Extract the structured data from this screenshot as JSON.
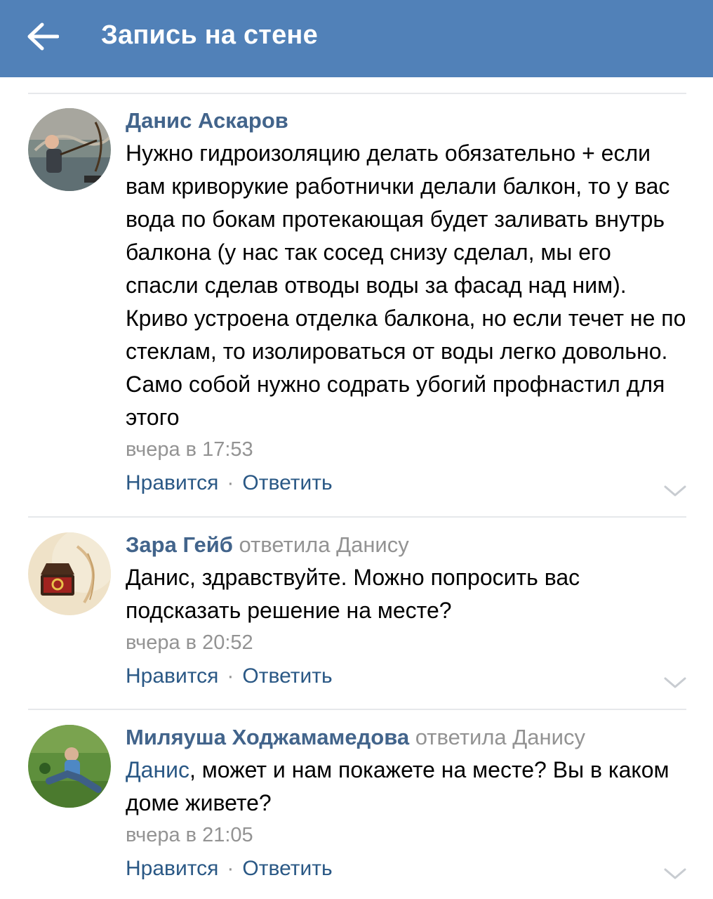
{
  "header": {
    "title": "Запись на стене",
    "back_icon": "arrow-left-icon",
    "background": "#5181b8"
  },
  "colors": {
    "author": "#42648b",
    "link": "#2a5885",
    "muted": "#939393",
    "text": "#000000"
  },
  "comments": [
    {
      "author": "Данис Аскаров",
      "replied_to": "",
      "mention": "",
      "text": "Нужно гидроизоляцию делать обязательно + если вам криворукие работнички делали балкон, то у вас вода по бокам протекающая будет заливать внутрь балкона (у нас так сосед снизу сделал, мы его спасли сделав отводы воды за фасад над ним). Криво устроена отделка балкона, но если течет не по стеклам, то изолироваться от воды легко довольно. Само собой нужно содрать убогий профнастил для этого",
      "time": "вчера в 17:53",
      "like_label": "Нравится",
      "separator": "·",
      "reply_label": "Ответить"
    },
    {
      "author": "Зара Гейб",
      "replied_to": "ответила Данису",
      "mention": "",
      "text": "Данис, здравствуйте. Можно попросить вас подсказать решение на месте?",
      "time": "вчера в 20:52",
      "like_label": "Нравится",
      "separator": "·",
      "reply_label": "Ответить"
    },
    {
      "author": "Миляуша Ходжамамедова",
      "replied_to": "ответила Данису",
      "mention": "Данис",
      "text": ", может и нам покажете на месте? Вы в каком доме живете?",
      "time": "вчера в 21:05",
      "like_label": "Нравится",
      "separator": "·",
      "reply_label": "Ответить"
    }
  ]
}
